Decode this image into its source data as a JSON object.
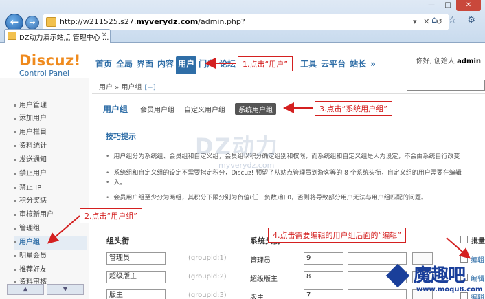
{
  "browser": {
    "url_prefix": "http://w211525.s27.",
    "url_domain": "myverydz.com",
    "url_suffix": "/admin.php?",
    "url_tools": "▾ ✕ ↺",
    "tab_title": "DZ动力演示站点 管理中心 ...",
    "tab_close": "✕",
    "back": "←",
    "forward": "→",
    "right_icons": "⌂ ☆ ⚙",
    "min": "—",
    "max": "□",
    "close": "✕"
  },
  "logo": {
    "brand": "Discuz!",
    "sub": "Control Panel"
  },
  "mainnav": [
    {
      "label": "首页"
    },
    {
      "label": "全局"
    },
    {
      "label": "界面"
    },
    {
      "label": "内容"
    },
    {
      "label": "用户",
      "active": true
    },
    {
      "label": "门户"
    },
    {
      "label": "论坛"
    },
    {
      "label": "工具"
    },
    {
      "label": "云平台"
    },
    {
      "label": "站长"
    },
    {
      "label": "»"
    }
  ],
  "greeting": {
    "prefix": "你好, 创始人",
    "user": "admin"
  },
  "sidebar": {
    "items": [
      "用户管理",
      "添加用户",
      "用户栏目",
      "资料统计",
      "发送通知",
      "禁止用户",
      "禁止 IP",
      "积分奖惩",
      "审核新用户",
      "管理组",
      "用户组",
      "明星会员",
      "推荐好友",
      "资料审核"
    ],
    "active_index": 10,
    "scroll_up": "▲",
    "scroll_down": "▼"
  },
  "breadcrumb": {
    "path": "用户 » 用户组",
    "plus": "[+]"
  },
  "subnav": {
    "lead": "用户组",
    "tabs": [
      "会员用户组",
      "自定义用户组",
      "系统用户组"
    ]
  },
  "tips": {
    "title": "技巧提示",
    "lines": [
      "用户组分为系统组、会员组和自定义组，会员组以积分确定组别和权限，而系统组和自定义组是人为设定，不会由系统自行改变",
      "系统组和自定义组的设定不需要指定积分，Discuz! 预留了从站点管理员到游客等的 8 个系统头衔，自定义组的用户需要在编辑",
      "入。",
      "会员用户组至少分为两组，其积分下限分别为负值(任一负数)和 0，否则将导致部分用户无法与用户组匹配的问题。"
    ]
  },
  "table": {
    "col_title": "组头衔",
    "col_sys": "系统头衔",
    "batch": "批量",
    "rows": [
      {
        "name": "管理员",
        "gid": "(groupid:1)",
        "sys": "管理员",
        "num": "9",
        "edit": "编辑"
      },
      {
        "name": "超级版主",
        "gid": "(groupid:2)",
        "sys": "超级版主",
        "num": "8",
        "edit": "编辑"
      },
      {
        "name": "版主",
        "gid": "(groupid:3)",
        "sys": "版主",
        "num": "7",
        "edit": "编辑"
      }
    ]
  },
  "watermark": {
    "big": "DZ动力",
    "small": "myverydz.com"
  },
  "moqu": {
    "text": "魔趣吧",
    "url": "www.moqu8.com"
  },
  "callouts": {
    "c1": "1.点击“用户”",
    "c2": "2.点击“用户组”",
    "c3": "3.点击“系统用户组”",
    "c4": "4.点击需要编辑的用户组后面的“编辑”"
  },
  "colors": {
    "accent": "#2f6ea7",
    "annotation": "#d42020",
    "logo": "#ef8a1d"
  }
}
